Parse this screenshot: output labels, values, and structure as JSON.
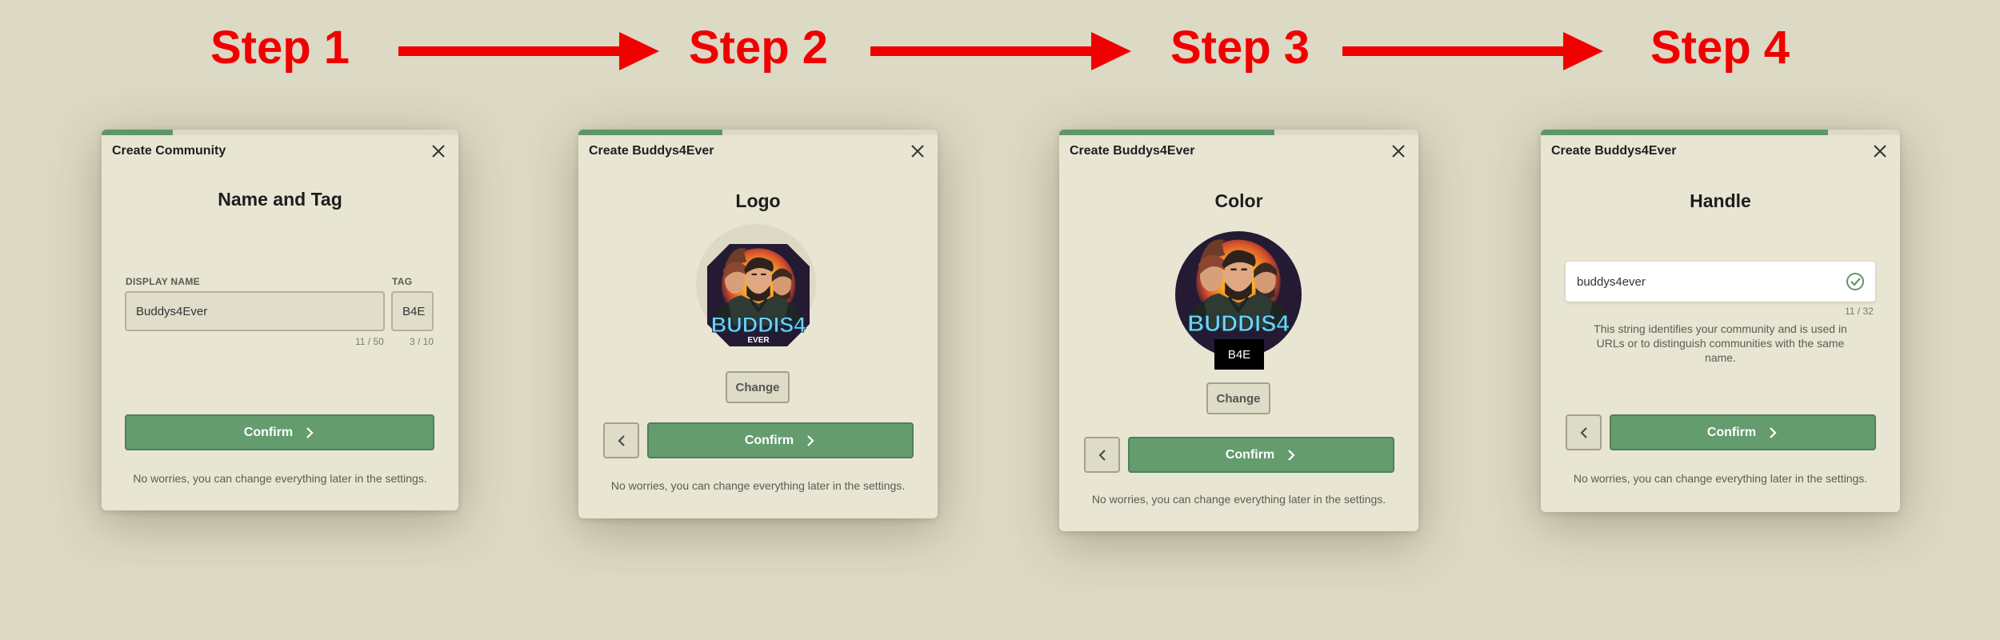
{
  "steps": [
    "Step 1",
    "Step 2",
    "Step 3",
    "Step 4"
  ],
  "colors": {
    "accent": "#659c6e",
    "step_label": "#f00000",
    "background": "#dcd9c4",
    "dialog": "#e8e5d3"
  },
  "dialog1": {
    "title": "Create Community",
    "heading": "Name and Tag",
    "progress": 0.2,
    "display_name_label": "DISPLAY NAME",
    "display_name_value": "Buddys4Ever",
    "display_name_count": "11 / 50",
    "tag_label": "TAG",
    "tag_value": "B4E",
    "tag_count": "3 / 10",
    "confirm_label": "Confirm",
    "footer": "No worries, you can change everything later in the settings."
  },
  "dialog2": {
    "title": "Create Buddys4Ever",
    "heading": "Logo",
    "progress": 0.4,
    "logo_text": "BUDDIS4",
    "logo_subtext": "EVER",
    "change_label": "Change",
    "confirm_label": "Confirm",
    "footer": "No worries, you can change everything later in the settings."
  },
  "dialog3": {
    "title": "Create Buddys4Ever",
    "heading": "Color",
    "progress": 0.6,
    "logo_text": "BUDDIS4",
    "badge": "B4E",
    "change_label": "Change",
    "confirm_label": "Confirm",
    "footer": "No worries, you can change everything later in the settings."
  },
  "dialog4": {
    "title": "Create Buddys4Ever",
    "heading": "Handle",
    "progress": 0.8,
    "handle_value": "buddys4ever",
    "handle_count": "11 / 32",
    "helper": "This string identifies your community and is used in URLs or to distinguish communities with the same name.",
    "confirm_label": "Confirm",
    "footer": "No worries, you can change everything later in the settings."
  },
  "icons": {
    "close": "close-icon",
    "chevron_right": "chevron-right-icon",
    "chevron_left": "chevron-left-icon",
    "check": "check-circle-icon"
  }
}
